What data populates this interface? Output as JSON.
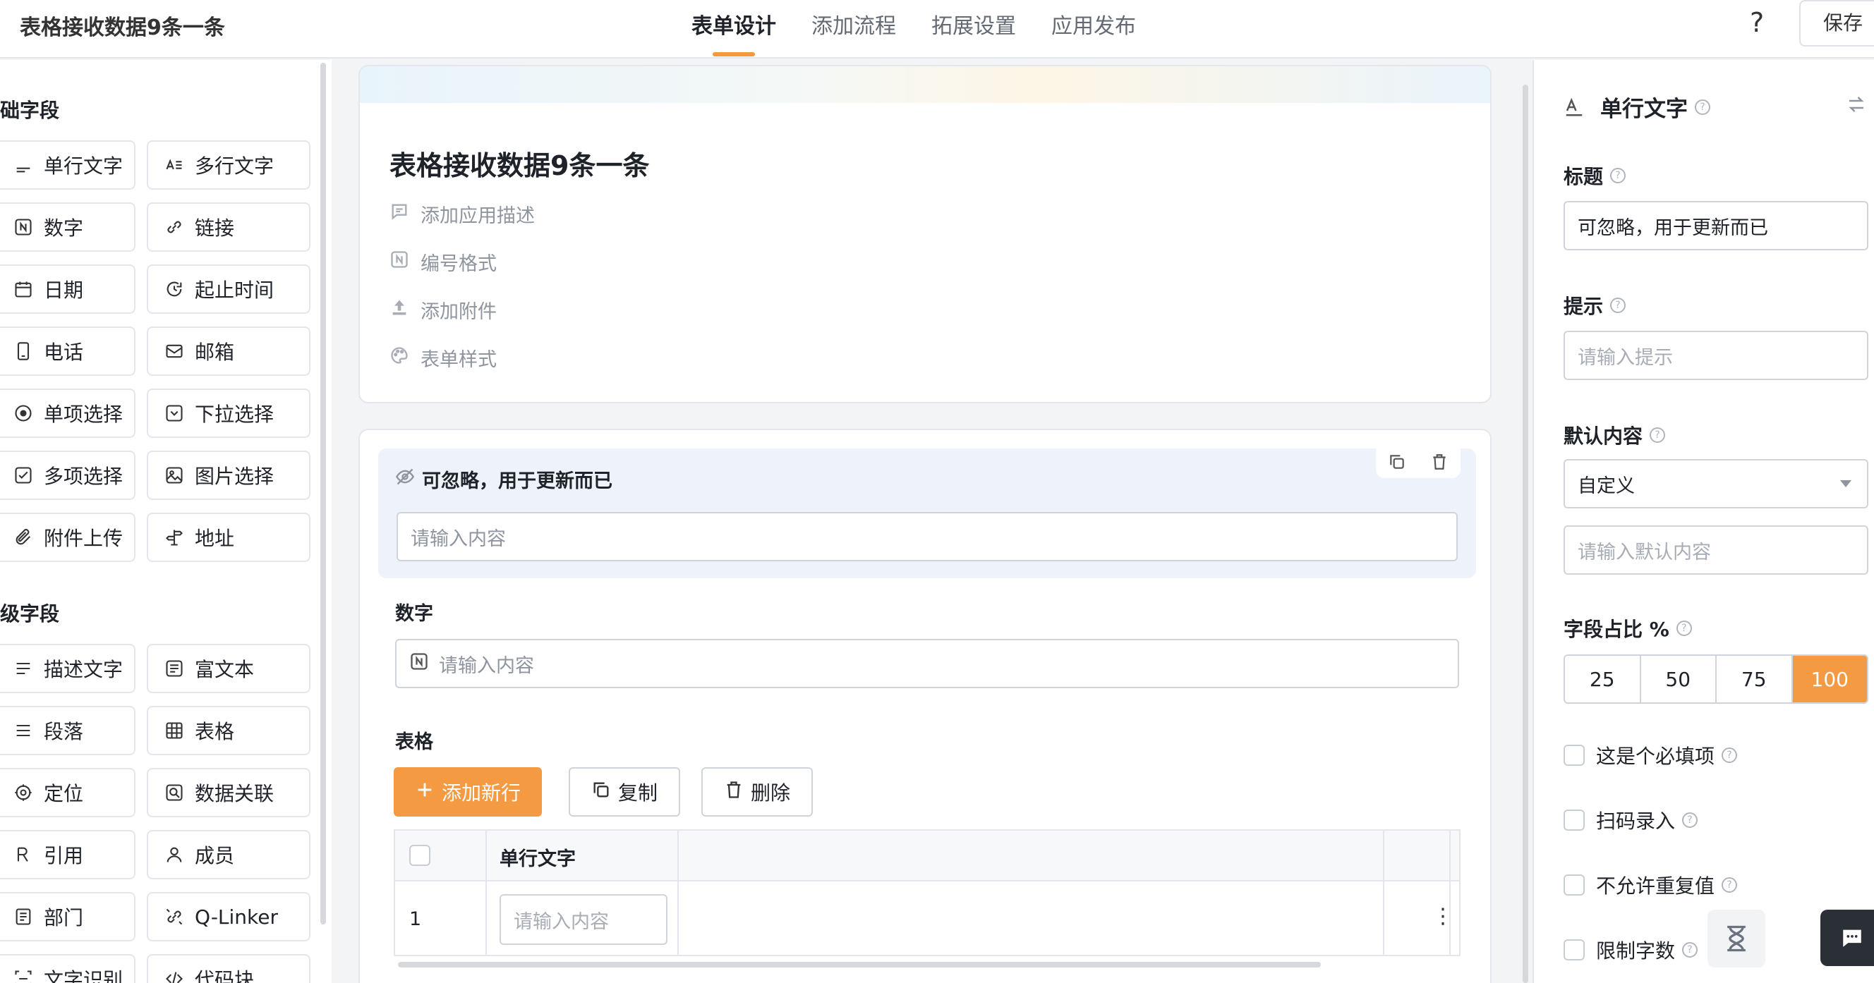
{
  "header": {
    "app_title": "表格接收数据9条一条",
    "tabs": [
      {
        "label": "表单设计",
        "active": true
      },
      {
        "label": "添加流程",
        "active": false
      },
      {
        "label": "拓展设置",
        "active": false
      },
      {
        "label": "应用发布",
        "active": false
      }
    ],
    "help_label": "?",
    "save_label": "保存"
  },
  "left_panel": {
    "basic_title": "础字段",
    "basic_fields": [
      {
        "label": "单行文字",
        "icon": "text-line-icon"
      },
      {
        "label": "多行文字",
        "icon": "text-multi-icon"
      },
      {
        "label": "数字",
        "icon": "number-icon"
      },
      {
        "label": "链接",
        "icon": "link-icon"
      },
      {
        "label": "日期",
        "icon": "calendar-icon"
      },
      {
        "label": "起止时间",
        "icon": "time-range-icon"
      },
      {
        "label": "电话",
        "icon": "phone-icon"
      },
      {
        "label": "邮箱",
        "icon": "mail-icon"
      },
      {
        "label": "单项选择",
        "icon": "radio-icon"
      },
      {
        "label": "下拉选择",
        "icon": "dropdown-icon"
      },
      {
        "label": "多项选择",
        "icon": "checkbox-icon"
      },
      {
        "label": "图片选择",
        "icon": "image-icon"
      },
      {
        "label": "附件上传",
        "icon": "attachment-icon"
      },
      {
        "label": "地址",
        "icon": "address-icon"
      }
    ],
    "advanced_title": "级字段",
    "advanced_fields": [
      {
        "label": "描述文字",
        "icon": "description-icon"
      },
      {
        "label": "富文本",
        "icon": "rich-text-icon"
      },
      {
        "label": "段落",
        "icon": "paragraph-icon"
      },
      {
        "label": "表格",
        "icon": "table-icon"
      },
      {
        "label": "定位",
        "icon": "location-icon"
      },
      {
        "label": "数据关联",
        "icon": "data-link-icon"
      },
      {
        "label": "引用",
        "icon": "quote-icon"
      },
      {
        "label": "成员",
        "icon": "member-icon"
      },
      {
        "label": "部门",
        "icon": "department-icon"
      },
      {
        "label": "Q-Linker",
        "icon": "q-linker-icon"
      },
      {
        "label": "文字识别",
        "icon": "ocr-icon"
      },
      {
        "label": "代码块",
        "icon": "code-icon"
      }
    ]
  },
  "form_header": {
    "title": "表格接收数据9条一条",
    "meta": [
      {
        "label": "添加应用描述",
        "icon": "comment-icon"
      },
      {
        "label": "编号格式",
        "icon": "number-format-icon"
      },
      {
        "label": "添加附件",
        "icon": "upload-icon"
      },
      {
        "label": "表单样式",
        "icon": "palette-icon"
      }
    ]
  },
  "form_body": {
    "selected_field": {
      "label": "可忽略，用于更新而已",
      "placeholder": "请输入内容"
    },
    "number_field": {
      "label": "数字",
      "placeholder": "请输入内容"
    },
    "table_field": {
      "label": "表格",
      "add_row_label": "添加新行",
      "copy_label": "复制",
      "delete_label": "删除",
      "column_header": "单行文字",
      "rows": [
        {
          "index": "1",
          "placeholder": "请输入内容"
        }
      ]
    }
  },
  "right_panel": {
    "title": "单行文字",
    "title_label": "标题",
    "title_value": "可忽略，用于更新而已",
    "hint_label": "提示",
    "hint_placeholder": "请输入提示",
    "default_label": "默认内容",
    "default_select": "自定义",
    "default_placeholder": "请输入默认内容",
    "width_label": "字段占比 %",
    "width_options": [
      "25",
      "50",
      "75",
      "100"
    ],
    "width_selected": "100",
    "checks": [
      {
        "label": "这是个必填项",
        "checked": false
      },
      {
        "label": "扫码录入",
        "checked": false
      },
      {
        "label": "不允许重复值",
        "checked": false
      },
      {
        "label": "限制字数",
        "checked": false
      }
    ]
  },
  "colors": {
    "accent": "#f39a43",
    "selected_bg": "#eef2fb",
    "border": "#d0d3d9"
  }
}
